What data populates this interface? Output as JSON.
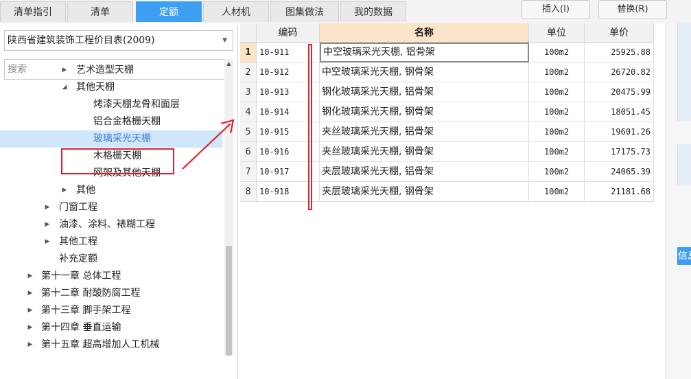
{
  "tabs": [
    {
      "label": "清单指引"
    },
    {
      "label": "清单"
    },
    {
      "label": "定额"
    },
    {
      "label": "人材机"
    },
    {
      "label": "图集做法"
    },
    {
      "label": "我的数据"
    }
  ],
  "active_tab_index": 2,
  "toolbar": {
    "insert_label": "插入(I)",
    "replace_label": "替换(R)"
  },
  "library": {
    "selected": "陕西省建筑装饰工程价目表(2009)"
  },
  "search": {
    "placeholder": "搜索",
    "value": ""
  },
  "tree": [
    {
      "label": "艺术造型天棚",
      "level": 3,
      "arrow": "collapsed"
    },
    {
      "label": "其他天棚",
      "level": 3,
      "arrow": "expanded"
    },
    {
      "label": "烤漆天棚龙骨和面层",
      "level": 4,
      "arrow": "none"
    },
    {
      "label": "铝合金格栅天棚",
      "level": 4,
      "arrow": "none"
    },
    {
      "label": "玻璃采光天棚",
      "level": 4,
      "arrow": "none",
      "selected": true
    },
    {
      "label": "木格栅天棚",
      "level": 4,
      "arrow": "none"
    },
    {
      "label": "网架及其他天棚",
      "level": 4,
      "arrow": "none"
    },
    {
      "label": "其他",
      "level": 3,
      "arrow": "collapsed"
    },
    {
      "label": "门窗工程",
      "level": 2,
      "arrow": "collapsed"
    },
    {
      "label": "油漆、涂料、裱糊工程",
      "level": 2,
      "arrow": "collapsed"
    },
    {
      "label": "其他工程",
      "level": 2,
      "arrow": "collapsed"
    },
    {
      "label": "补充定额",
      "level": 2,
      "arrow": "none"
    },
    {
      "label": "第十一章 总体工程",
      "level": 1,
      "arrow": "collapsed"
    },
    {
      "label": "第十二章 耐酸防腐工程",
      "level": 1,
      "arrow": "collapsed"
    },
    {
      "label": "第十三章 脚手架工程",
      "level": 1,
      "arrow": "collapsed"
    },
    {
      "label": "第十四章 垂直运输",
      "level": 1,
      "arrow": "collapsed"
    },
    {
      "label": "第十五章 超高增加人工机械",
      "level": 1,
      "arrow": "collapsed"
    }
  ],
  "grid": {
    "columns": [
      "编码",
      "名称",
      "单位",
      "单价"
    ],
    "rows": [
      {
        "no": "1",
        "code": "10-911",
        "name": "中空玻璃采光天棚, 铝骨架",
        "unit": "100m2",
        "price": "25925.88"
      },
      {
        "no": "2",
        "code": "10-912",
        "name": "中空玻璃采光天棚, 钢骨架",
        "unit": "100m2",
        "price": "26720.82"
      },
      {
        "no": "3",
        "code": "10-913",
        "name": "钢化玻璃采光天棚, 铝骨架",
        "unit": "100m2",
        "price": "20475.99"
      },
      {
        "no": "4",
        "code": "10-914",
        "name": "钢化玻璃采光天棚, 钢骨架",
        "unit": "100m2",
        "price": "18051.45"
      },
      {
        "no": "5",
        "code": "10-915",
        "name": "夹丝玻璃采光天棚, 铝骨架",
        "unit": "100m2",
        "price": "19601.26"
      },
      {
        "no": "6",
        "code": "10-916",
        "name": "夹丝玻璃采光天棚, 钢骨架",
        "unit": "100m2",
        "price": "17175.73"
      },
      {
        "no": "7",
        "code": "10-917",
        "name": "夹层玻璃采光天棚, 铝骨架",
        "unit": "100m2",
        "price": "24065.39"
      },
      {
        "no": "8",
        "code": "10-918",
        "name": "夹层玻璃采光天棚, 钢骨架",
        "unit": "100m2",
        "price": "21181.68"
      }
    ]
  },
  "side_panel": {
    "tab_label": "信息"
  },
  "colors": {
    "accent": "#3d9ef2",
    "annotation": "#e0202a",
    "selected_row": "#cfe6fb",
    "header_highlight": "#fbe4c7"
  }
}
